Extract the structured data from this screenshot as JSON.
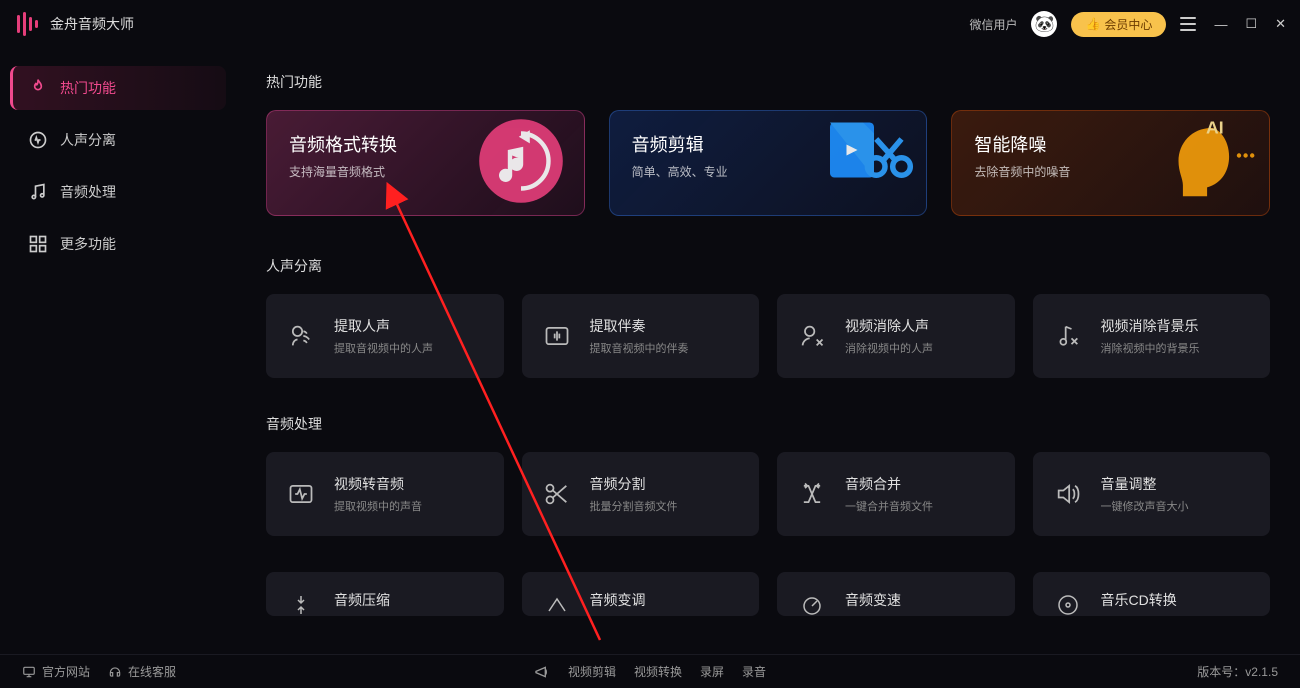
{
  "app_title": "金舟音频大师",
  "header": {
    "user_label": "微信用户",
    "vip_label": "会员中心"
  },
  "sidebar": {
    "items": [
      {
        "label": "热门功能",
        "active": true
      },
      {
        "label": "人声分离",
        "active": false
      },
      {
        "label": "音频处理",
        "active": false
      },
      {
        "label": "更多功能",
        "active": false
      }
    ]
  },
  "sections": {
    "hot": {
      "title": "热门功能",
      "cards": [
        {
          "title": "音频格式转换",
          "subtitle": "支持海量音频格式"
        },
        {
          "title": "音频剪辑",
          "subtitle": "简单、高效、专业"
        },
        {
          "title": "智能降噪",
          "subtitle": "去除音频中的噪音"
        }
      ]
    },
    "voice": {
      "title": "人声分离",
      "cards": [
        {
          "title": "提取人声",
          "subtitle": "提取音视频中的人声"
        },
        {
          "title": "提取伴奏",
          "subtitle": "提取音视频中的伴奏"
        },
        {
          "title": "视频消除人声",
          "subtitle": "消除视频中的人声"
        },
        {
          "title": "视频消除背景乐",
          "subtitle": "消除视频中的背景乐"
        }
      ]
    },
    "audio": {
      "title": "音频处理",
      "cards_row1": [
        {
          "title": "视频转音频",
          "subtitle": "提取视频中的声音"
        },
        {
          "title": "音频分割",
          "subtitle": "批量分割音频文件"
        },
        {
          "title": "音频合并",
          "subtitle": "一键合并音频文件"
        },
        {
          "title": "音量调整",
          "subtitle": "一键修改声音大小"
        }
      ],
      "cards_row2": [
        {
          "title": "音频压缩"
        },
        {
          "title": "音频变调"
        },
        {
          "title": "音频变速"
        },
        {
          "title": "音乐CD转换"
        }
      ]
    }
  },
  "footer": {
    "official": "官方网站",
    "support": "在线客服",
    "center": [
      "视频剪辑",
      "视频转换",
      "录屏",
      "录音"
    ],
    "version_label": "版本号：",
    "version": "v2.1.5"
  }
}
